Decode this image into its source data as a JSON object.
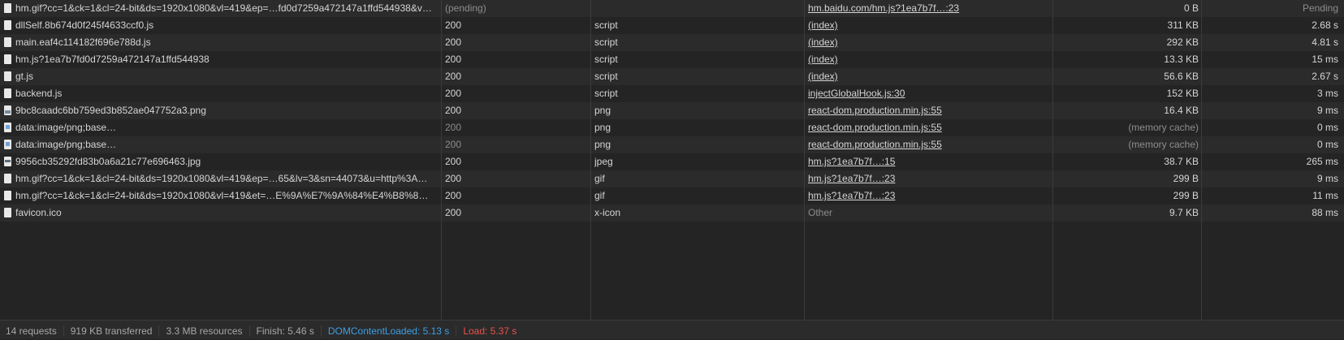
{
  "requests": [
    {
      "name": "hm.gif?cc=1&ck=1&cl=24-bit&ds=1920x1080&vl=419&ep=…fd0d7259a472147a1ffd544938&v…",
      "status": "(pending)",
      "type": "",
      "initiator": "hm.baidu.com/hm.js?1ea7b7f…:23",
      "size": "0 B",
      "time": "Pending",
      "icon": "file-icon"
    },
    {
      "name": "dllSelf.8b674d0f245f4633ccf0.js",
      "status": "200",
      "type": "script",
      "initiator": "(index)",
      "size": "311 KB",
      "time": "2.68 s",
      "icon": "file-icon"
    },
    {
      "name": "main.eaf4c114182f696e788d.js",
      "status": "200",
      "type": "script",
      "initiator": "(index)",
      "size": "292 KB",
      "time": "4.81 s",
      "icon": "file-icon"
    },
    {
      "name": "hm.js?1ea7b7fd0d7259a472147a1ffd544938",
      "status": "200",
      "type": "script",
      "initiator": "(index)",
      "size": "13.3 KB",
      "time": "15 ms",
      "icon": "file-icon"
    },
    {
      "name": "gt.js",
      "status": "200",
      "type": "script",
      "initiator": "(index)",
      "size": "56.6 KB",
      "time": "2.67 s",
      "icon": "file-icon"
    },
    {
      "name": "backend.js",
      "status": "200",
      "type": "script",
      "initiator": "injectGlobalHook.js:30",
      "size": "152 KB",
      "time": "3 ms",
      "icon": "file-icon"
    },
    {
      "name": "9bc8caadc6bb759ed3b852ae047752a3.png",
      "status": "200",
      "type": "png",
      "initiator": "react-dom.production.min.js:55",
      "size": "16.4 KB",
      "time": "9 ms",
      "icon": "image-icon"
    },
    {
      "name": "data:image/png;base…",
      "status": "200",
      "type": "png",
      "initiator": "react-dom.production.min.js:55",
      "size": "(memory cache)",
      "time": "0 ms",
      "icon": "data-image-icon"
    },
    {
      "name": "data:image/png;base…",
      "status": "200",
      "type": "png",
      "initiator": "react-dom.production.min.js:55",
      "size": "(memory cache)",
      "time": "0 ms",
      "icon": "data-image-icon"
    },
    {
      "name": "9956cb35292fd83b0a6a21c77e696463.jpg",
      "status": "200",
      "type": "jpeg",
      "initiator": "hm.js?1ea7b7f…:15",
      "size": "38.7 KB",
      "time": "265 ms",
      "icon": "jpeg-icon"
    },
    {
      "name": "hm.gif?cc=1&ck=1&cl=24-bit&ds=1920x1080&vl=419&ep=…65&lv=3&sn=44073&u=http%3A…",
      "status": "200",
      "type": "gif",
      "initiator": "hm.js?1ea7b7f…:23",
      "size": "299 B",
      "time": "9 ms",
      "icon": "file-icon"
    },
    {
      "name": "hm.gif?cc=1&ck=1&cl=24-bit&ds=1920x1080&vl=419&et=…E%9A%E7%9A%84%E4%B8%8…",
      "status": "200",
      "type": "gif",
      "initiator": "hm.js?1ea7b7f…:23",
      "size": "299 B",
      "time": "11 ms",
      "icon": "file-icon"
    },
    {
      "name": "favicon.ico",
      "status": "200",
      "type": "x-icon",
      "initiator": "Other",
      "size": "9.7 KB",
      "time": "88 ms",
      "icon": "file-icon"
    }
  ],
  "summary": {
    "requests": "14 requests",
    "transferred": "919 KB transferred",
    "resources": "3.3 MB resources",
    "finish": "Finish: 5.46 s",
    "dom_content_loaded": "DOMContentLoaded: 5.13 s",
    "load": "Load: 5.37 s"
  },
  "colors": {
    "background": "#242424",
    "row_alt": "#2b2b2b",
    "text": "#d5d5d5",
    "dim_text": "#8d8d8d",
    "dom_content_loaded": "#3d9fe3",
    "load": "#e9524c"
  }
}
